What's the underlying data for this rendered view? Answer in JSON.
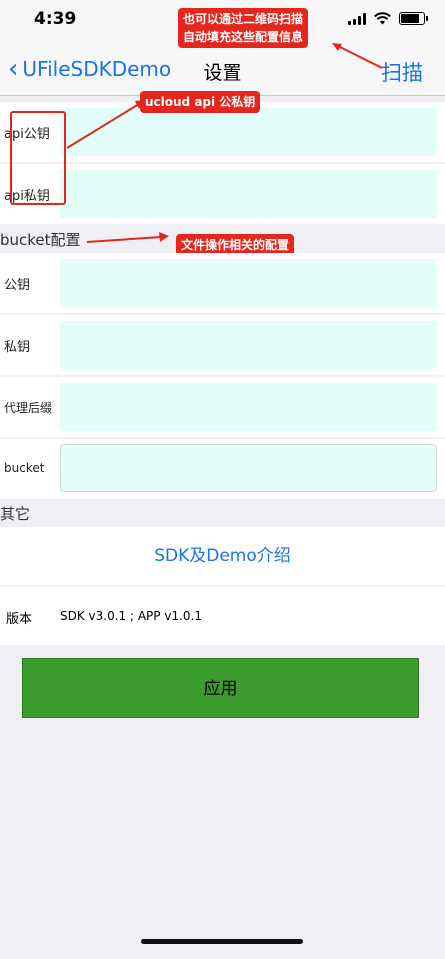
{
  "status": {
    "time": "4:39"
  },
  "nav": {
    "back_label": "UFileSDKDemo",
    "title": "设置",
    "action_label": "扫描"
  },
  "annotations": {
    "scan_note_line1": "也可以通过二维码扫描",
    "scan_note_line2": "自动填充这些配置信息",
    "api_note": "ucloud api 公私钥",
    "bucket_note": "文件操作相关的配置"
  },
  "api": {
    "public_key_label": "api公钥",
    "private_key_label": "api私钥",
    "public_key_value": "",
    "private_key_value": ""
  },
  "bucket_section": {
    "header": "bucket配置",
    "fields": [
      {
        "label": "公钥",
        "value": ""
      },
      {
        "label": "私钥",
        "value": ""
      },
      {
        "label": "代理后缀",
        "value": ""
      },
      {
        "label": "bucket",
        "value": ""
      }
    ]
  },
  "other_section": {
    "header": "其它",
    "intro_link": "SDK及Demo介绍",
    "version_label": "版本",
    "version_value": "SDK v3.0.1 ; APP v1.0.1"
  },
  "apply_label": "应用",
  "colors": {
    "accent": "#1a73e8",
    "input_bg": "#e3fef8",
    "apply": "#3b9b2d",
    "annotation": "#e5261d"
  }
}
